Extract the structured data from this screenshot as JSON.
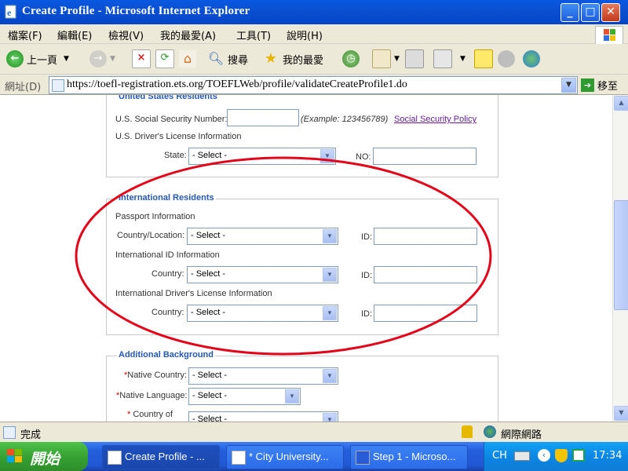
{
  "window": {
    "title": "Create Profile - Microsoft Internet Explorer",
    "min": "_",
    "max": "□",
    "close": "✕"
  },
  "menu": [
    "檔案(F)",
    "編輯(E)",
    "檢視(V)",
    "我的最愛(A)",
    "工具(T)",
    "說明(H)"
  ],
  "toolbar": {
    "back": "上一頁",
    "search": "搜尋",
    "favorites": "我的最愛"
  },
  "address": {
    "label": "網址(D)",
    "url": "https://toefl-registration.ets.org/TOEFLWeb/profile/validateCreateProfile1.do",
    "go": "移至"
  },
  "form": {
    "us_section": {
      "legend": "United States Residents",
      "ssn_label": "U.S. Social Security Number:",
      "ssn_example": "(Example: 123456789)",
      "ssn_policy_link": "Social Security Policy",
      "dl_heading": "U.S. Driver's License Information",
      "state_label": "State:",
      "state_value": "- Select -",
      "no_label": "NO:"
    },
    "intl_section": {
      "legend": "International Residents",
      "passport_heading": "Passport Information",
      "passport_country_label": "Country/Location:",
      "passport_country_value": "- Select -",
      "passport_id_label": "ID:",
      "intl_id_heading": "International ID Information",
      "intl_id_country_label": "Country:",
      "intl_id_country_value": "- Select -",
      "intl_id_label": "ID:",
      "dl_heading": "International Driver's License Information",
      "dl_country_label": "Country:",
      "dl_country_value": "- Select -",
      "dl_id_label": "ID:"
    },
    "background_section": {
      "legend": "Additional Background",
      "native_country_label": "Native Country:",
      "native_country_value": "- Select -",
      "native_language_label": "Native Language:",
      "native_language_value": "- Select -",
      "country_of_label_1": "Country of",
      "country_of_value": "- Select -"
    },
    "required_marker": "*"
  },
  "status": {
    "text": "完成",
    "zone": "網際網路"
  },
  "taskbar": {
    "start": "開始",
    "tasks": [
      "Create Profile - ...",
      "* City University...",
      "Step 1 - Microso..."
    ],
    "lang": "CH",
    "time": "17:34"
  },
  "colors": {
    "annotation_ring": "#e3061a",
    "legend_blue": "#2457b5",
    "title_blue": "#0a4fd1"
  }
}
